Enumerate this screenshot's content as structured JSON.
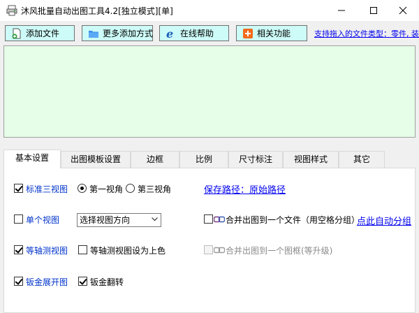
{
  "window": {
    "title": "沐风批量自动出图工具4.2[独立模式][单]",
    "icon": "app-printer-icon"
  },
  "toolbar": {
    "add_file": "添加文件",
    "more_add": "更多添加方式",
    "online_help": "在线帮助",
    "related": "相关功能",
    "support_link": "支持拖入的文件类型：零件, 装配"
  },
  "tabs": [
    "基本设置",
    "出图模板设置",
    "边框",
    "比例",
    "尺寸标注",
    "视图样式",
    "其它"
  ],
  "settings": {
    "std_three_view": "标准三视图",
    "first_angle": "第一视角",
    "third_angle": "第三视角",
    "save_path": "保存路径：原始路径",
    "single_view": "单个视图",
    "view_dir_select": "选择视图方向",
    "merge_one_file": "合并出图到一个文件（用空格分组）",
    "auto_group": "点此自动分组",
    "iso_view": "等轴测视图",
    "iso_color": "等轴测视图设为上色",
    "merge_one_frame": "合并出图到一个图框(等升级)",
    "sheet_flat": "钣金展开图",
    "sheet_flip": "钣金翻转"
  },
  "state": {
    "std_three_view": true,
    "angle": "first",
    "single_view": false,
    "merge_one_file": false,
    "iso_view": true,
    "iso_color": false,
    "merge_one_frame": false,
    "sheet_flat": true,
    "sheet_flip": true
  },
  "colors": {
    "button_bg": "#cdfbf7",
    "file_area_bg": "#e6fde8",
    "link": "#0000ee",
    "blue_label": "#0033cc"
  }
}
